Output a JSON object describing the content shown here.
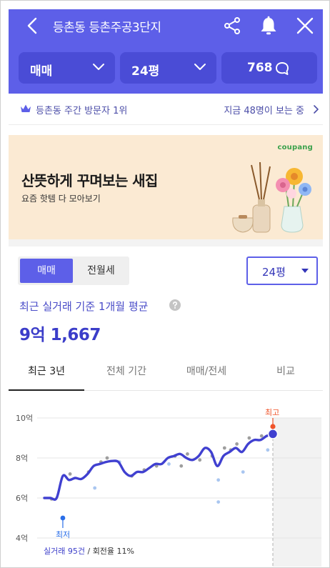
{
  "header": {
    "title": "등촌동 등촌주공3단지",
    "trade_type": "매매",
    "area": "24평",
    "comments": "768"
  },
  "rank": {
    "text": "등촌동 주간 방문자 1위",
    "viewers": "지금 48명이 보는 중"
  },
  "ad": {
    "brand": "coupang",
    "headline": "산뜻하게 꾸며보는 새집",
    "sub": "요즘 핫템 다 모아보기"
  },
  "filters": {
    "seg_sale": "매매",
    "seg_rent": "전월세",
    "area": "24평"
  },
  "summary": {
    "label": "최근 실거래 기준 1개월 평균",
    "price": "9억 1,667"
  },
  "tabs": [
    "최근 3년",
    "전체 기간",
    "매매/전세",
    "비교"
  ],
  "colors": {
    "brand": "#5d5fe8",
    "line": "#4040d0",
    "high": "#f0542a",
    "low": "#2a6ee8"
  },
  "chart_data": {
    "type": "line",
    "y_ticks": [
      "10억",
      "8억",
      "6억",
      "4억"
    ],
    "ylim": [
      4,
      10.6
    ],
    "markers": {
      "high": "최고",
      "low": "최저"
    },
    "trades_label": "실거래 95건",
    "turnover_label": "회전율 11%",
    "series": [
      {
        "values": [
          6,
          6,
          6,
          7.1,
          6.9,
          7,
          6.95,
          7.2,
          7.6,
          7.7,
          7.8,
          7.85,
          7.8,
          7.3,
          7.1,
          7.3,
          7.3,
          7.5,
          7.7,
          7.7,
          8,
          8.1,
          8.2,
          8,
          7.9,
          8.1,
          8.5,
          8.3,
          7.6,
          8.1,
          8.3,
          8.5,
          8.3,
          8.7,
          8.9,
          8.9,
          9.1,
          9.2
        ]
      }
    ],
    "points": [
      {
        "i": 1,
        "v": 5.95,
        "kind": "sale"
      },
      {
        "i": 4,
        "v": 7.2,
        "kind": "sale"
      },
      {
        "i": 7,
        "v": 7.3,
        "kind": "sale"
      },
      {
        "i": 8,
        "v": 6.5,
        "kind": "alt"
      },
      {
        "i": 9,
        "v": 7.8,
        "kind": "sale"
      },
      {
        "i": 10,
        "v": 8,
        "kind": "sale"
      },
      {
        "i": 12,
        "v": 7.8,
        "kind": "alt"
      },
      {
        "i": 14,
        "v": 7.1,
        "kind": "sale"
      },
      {
        "i": 16,
        "v": 7.4,
        "kind": "sale"
      },
      {
        "i": 18,
        "v": 7.6,
        "kind": "sale"
      },
      {
        "i": 20,
        "v": 7.7,
        "kind": "alt"
      },
      {
        "i": 21,
        "v": 8.1,
        "kind": "sale"
      },
      {
        "i": 22,
        "v": 7.6,
        "kind": "sale"
      },
      {
        "i": 23,
        "v": 8.2,
        "kind": "sale"
      },
      {
        "i": 25,
        "v": 7.9,
        "kind": "sale"
      },
      {
        "i": 27,
        "v": 8.1,
        "kind": "sale"
      },
      {
        "i": 28,
        "v": 6.9,
        "kind": "alt"
      },
      {
        "i": 28,
        "v": 5.8,
        "kind": "alt"
      },
      {
        "i": 29,
        "v": 8.5,
        "kind": "sale"
      },
      {
        "i": 30,
        "v": 8.4,
        "kind": "sale"
      },
      {
        "i": 31,
        "v": 8.7,
        "kind": "sale"
      },
      {
        "i": 32,
        "v": 7.3,
        "kind": "alt"
      },
      {
        "i": 33,
        "v": 9,
        "kind": "sale"
      },
      {
        "i": 35,
        "v": 9.1,
        "kind": "sale"
      },
      {
        "i": 36,
        "v": 8.4,
        "kind": "alt"
      }
    ],
    "low_point": {
      "i": 3,
      "v": 5
    },
    "high_point": {
      "i": 37,
      "v": 9.5
    }
  }
}
